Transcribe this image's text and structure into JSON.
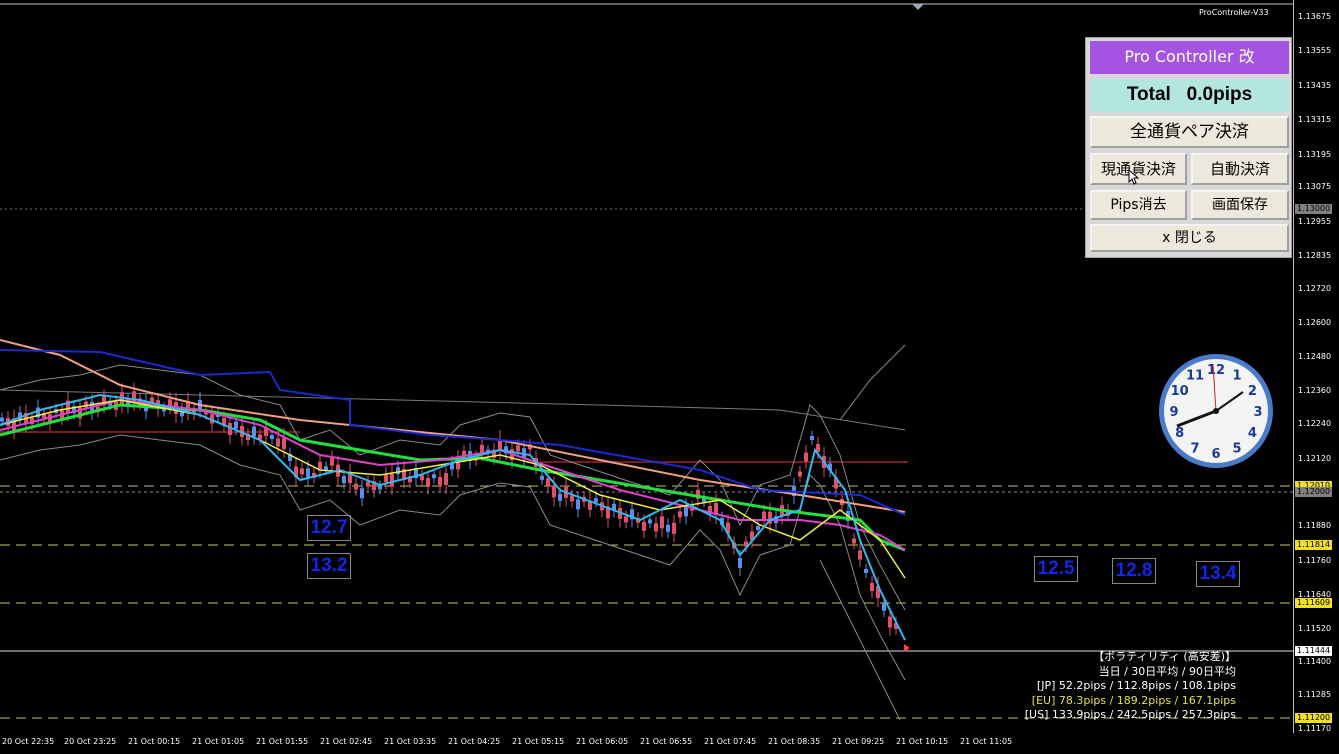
{
  "ea_name": "ProController-V33",
  "panel": {
    "title": "Pro Controller 改",
    "total_label": "Total",
    "total_value": "0.0pips",
    "close_all_pairs": "全通貨ペア決済",
    "close_current": "現通貨決済",
    "auto_close": "自動決済",
    "pips_clear": "Pips消去",
    "screen_save": "画面保存",
    "close_panel": "x 閉じる",
    "title_color": "#a454e0",
    "total_color": "#b4e6e0"
  },
  "volatility": {
    "heading": "【ボラティリティ (高安差)】",
    "subheading": "当日 / 30日平均 / 90日平均",
    "jp": "[JP] 52.2pips / 112.8pips / 108.1pips",
    "eu": "[EU] 78.3pips / 189.2pips / 167.1pips",
    "us": "[US] 133.9pips / 242.5pips / 257.3pips"
  },
  "pip_labels": [
    "12.7",
    "13.2",
    "12.5",
    "12.8",
    "13.4"
  ],
  "price_axis": [
    "1.13675",
    "1.13555",
    "1.13435",
    "1.13315",
    "1.13195",
    "1.13075",
    "1.12955",
    "1.12835",
    "1.12720",
    "1.12600",
    "1.12480",
    "1.12360",
    "1.12240",
    "1.12120",
    "1.11880",
    "1.11760",
    "1.11640",
    "1.11520",
    "1.11400",
    "1.11285",
    "1.11170"
  ],
  "price_highlights": [
    {
      "text": "1.13000",
      "bg": "#808080"
    },
    {
      "text": "1.12010",
      "bg": "#f0e020"
    },
    {
      "text": "1.12000",
      "bg": "#808080"
    },
    {
      "text": "1.11814",
      "bg": "#f0e020"
    },
    {
      "text": "1.11609",
      "bg": "#f0e020"
    },
    {
      "text": "1.11444",
      "bg": "#ffffff"
    },
    {
      "text": "1.11200",
      "bg": "#f0e020"
    }
  ],
  "time_axis": [
    "20 Oct 22:35",
    "20 Oct 23:25",
    "21 Oct 00:15",
    "21 Oct 01:05",
    "21 Oct 01:55",
    "21 Oct 02:45",
    "21 Oct 03:35",
    "21 Oct 04:25",
    "21 Oct 05:15",
    "21 Oct 06:05",
    "21 Oct 06:55",
    "21 Oct 07:45",
    "21 Oct 08:35",
    "21 Oct 09:25",
    "21 Oct 10:15",
    "21 Oct 11:05"
  ],
  "colors": {
    "eu_text": "#e8e040",
    "jp_text": "#ffffff",
    "us_text": "#ffffff",
    "pip_text": "#1226e6"
  }
}
